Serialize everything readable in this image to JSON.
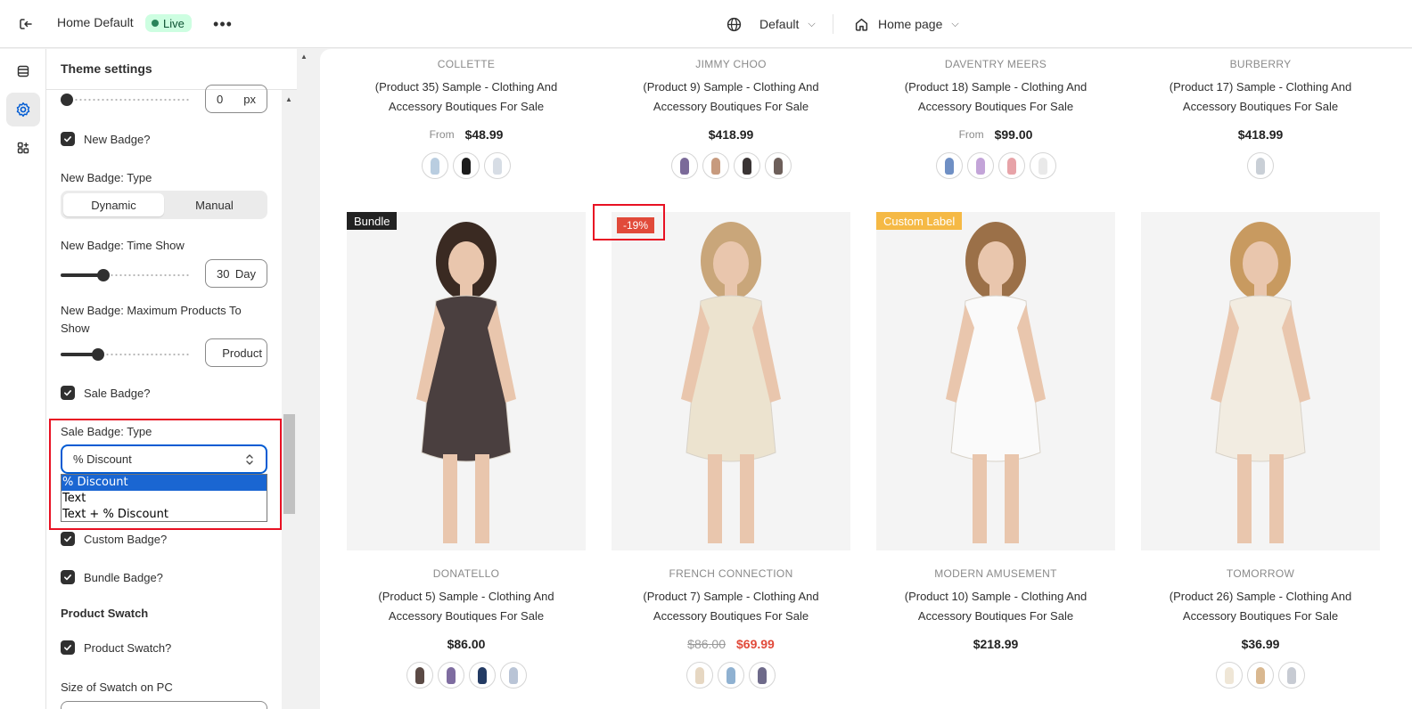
{
  "topbar": {
    "title": "Home Default",
    "live_label": "Live",
    "more_label": "•••",
    "theme_label": "Default",
    "page_label": "Home page"
  },
  "panel": {
    "header": "Theme settings",
    "top_px_value": "0",
    "top_px_unit": "px",
    "new_badge_label": "New Badge?",
    "new_badge_type_label": "New Badge: Type",
    "new_badge_type_options": [
      "Dynamic",
      "Manual"
    ],
    "new_badge_type_selected": "Dynamic",
    "time_show_label": "New Badge: Time Show",
    "time_show_value": "30",
    "time_show_unit": "Day",
    "time_show_level": 0.33,
    "max_products_label": "New Badge: Maximum Products To Show",
    "max_products_value": "Product",
    "max_products_level": 0.29,
    "sale_badge_label": "Sale Badge?",
    "sale_badge_type_label": "Sale Badge: Type",
    "sale_badge_type_selected": "% Discount",
    "sale_badge_type_options": [
      "% Discount",
      "Text",
      "Text + % Discount"
    ],
    "custom_badge_label": "Custom Badge?",
    "bundle_badge_label": "Bundle Badge?",
    "product_swatch_section": "Product Swatch",
    "product_swatch_label": "Product Swatch?",
    "swatch_size_label": "Size of Swatch on PC"
  },
  "products_top": [
    {
      "brand": "COLLETTE",
      "name": "(Product 35) Sample - Clothing And Accessory Boutiques For Sale",
      "from": "From",
      "price": "$48.99",
      "swatches": [
        "#b9cde0",
        "#1c1c1c",
        "#d7dde5"
      ]
    },
    {
      "brand": "JIMMY CHOO",
      "name": "(Product 9) Sample - Clothing And Accessory Boutiques For Sale",
      "from": "",
      "price": "$418.99",
      "swatches": [
        "#7b6a99",
        "#c79a7e",
        "#3a3434",
        "#6d5f5a"
      ]
    },
    {
      "brand": "DAVENTRY MEERS",
      "name": "(Product 18) Sample - Clothing And Accessory Boutiques For Sale",
      "from": "From",
      "price": "$99.00",
      "swatches": [
        "#6f8fc4",
        "#c3a4d8",
        "#e7a3a8",
        "#e9e9e9"
      ]
    },
    {
      "brand": "BURBERRY",
      "name": "(Product 17) Sample - Clothing And Accessory Boutiques For Sale",
      "from": "",
      "price": "$418.99",
      "swatches": [
        "#c9cfd6"
      ]
    }
  ],
  "products_bottom": [
    {
      "brand": "DONATELLO",
      "name": "(Product 5) Sample - Clothing And Accessory Boutiques For Sale",
      "badge": "Bundle",
      "badge_color": "#222222",
      "price": "$86.00",
      "old_price": "",
      "swatches": [
        "#5b4a45",
        "#7e6ca0",
        "#233a63",
        "#b9c4d6"
      ],
      "dress": "#4a3f3f"
    },
    {
      "brand": "FRENCH CONNECTION",
      "name": "(Product 7) Sample - Clothing And Accessory Boutiques For Sale",
      "badge": "-19%",
      "badge_color": "#e14a3a",
      "price": "$69.99",
      "old_price": "$86.00",
      "swatches": [
        "#e6d7c2",
        "#8fb1d1",
        "#6e6a8a"
      ],
      "dress": "#ece3cf"
    },
    {
      "brand": "MODERN AMUSEMENT",
      "name": "(Product 10) Sample - Clothing And Accessory Boutiques For Sale",
      "badge": "Custom Label",
      "badge_color": "#f5b945",
      "price": "$218.99",
      "old_price": "",
      "swatches": [],
      "dress": "#fafafa"
    },
    {
      "brand": "TOMORROW",
      "name": "(Product 26) Sample - Clothing And Accessory Boutiques For Sale",
      "badge": "",
      "badge_color": "",
      "price": "$36.99",
      "old_price": "",
      "swatches": [
        "#efe6d6",
        "#d9b890",
        "#c7cbd3"
      ],
      "dress": "#f2ece1"
    }
  ]
}
